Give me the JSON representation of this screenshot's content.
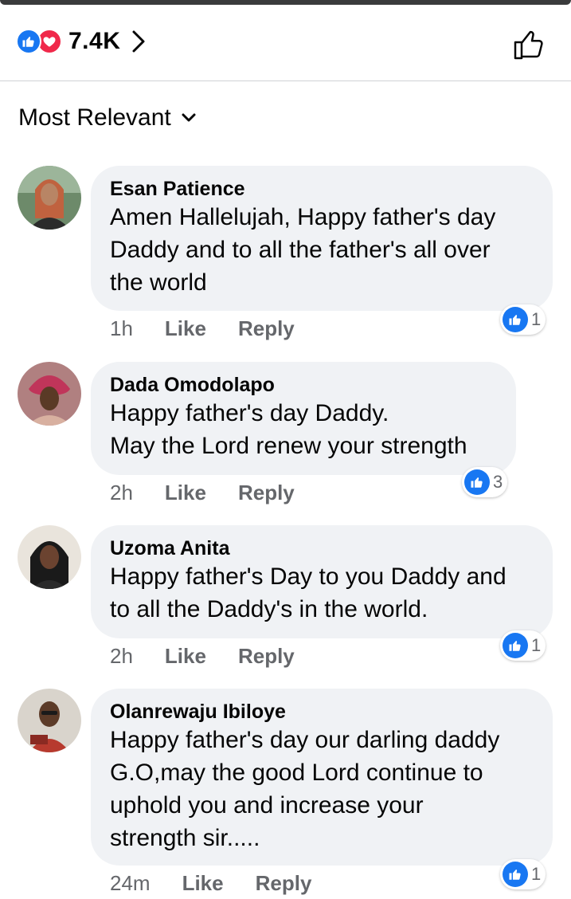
{
  "header": {
    "reaction_icons": [
      "like-icon",
      "love-icon"
    ],
    "reaction_count": "7.4K",
    "like_button_icon": "thumbs-up-outline-icon"
  },
  "sort": {
    "label": "Most Relevant",
    "icon": "chevron-down-icon"
  },
  "colors": {
    "like_blue": "#1877f2",
    "love_red": "#f0284a",
    "bubble_bg": "#f0f2f5",
    "meta_gray": "#65676b"
  },
  "comments": [
    {
      "author": "Esan Patience",
      "text": "Amen Hallelujah, Happy father's day\nDaddy and to all the father's all over\nthe world",
      "time": "1h",
      "like_label": "Like",
      "reply_label": "Reply",
      "reaction_count": "1"
    },
    {
      "author": "Dada Omodolapo",
      "text": "Happy father's day Daddy.\nMay the Lord renew your strength",
      "time": "2h",
      "like_label": "Like",
      "reply_label": "Reply",
      "reaction_count": "3"
    },
    {
      "author": "Uzoma Anita",
      "text": "Happy father's Day to you Daddy and\nto all the Daddy's in the world.",
      "time": "2h",
      "like_label": "Like",
      "reply_label": "Reply",
      "reaction_count": "1"
    },
    {
      "author": "Olanrewaju Ibiloye",
      "text": "Happy father's day our darling daddy\nG.O,may the good Lord continue to\nuphold you and increase your\nstrength sir.....",
      "time": "24m",
      "like_label": "Like",
      "reply_label": "Reply",
      "reaction_count": "1"
    }
  ]
}
